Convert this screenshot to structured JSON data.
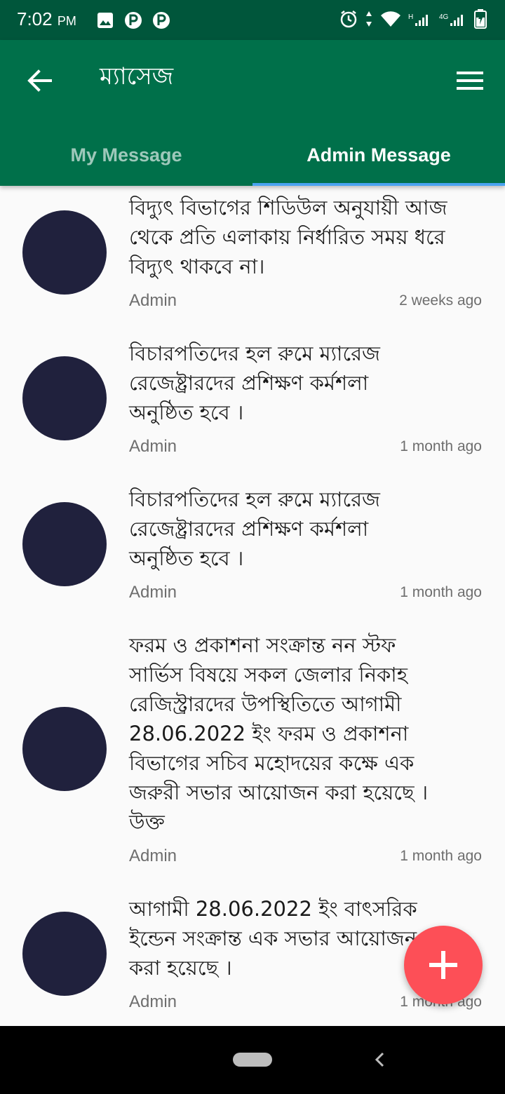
{
  "status_bar": {
    "time": "7:02",
    "ampm": "PM",
    "left_icons": [
      "image-icon",
      "parking-icon",
      "parking-icon"
    ],
    "right_icons": [
      "alarm-icon",
      "data-arrows-icon",
      "wifi-icon",
      "signal-h-icon",
      "signal-4g-icon",
      "battery-charging-icon"
    ],
    "network_h": "H",
    "network_4g": "4G"
  },
  "app_bar": {
    "title": "ম্যাসেজ",
    "back_icon": "arrow-left-icon",
    "menu_icon": "hamburger-menu-icon",
    "color": "#00704a"
  },
  "tabs": [
    {
      "label": "My Message",
      "active": false
    },
    {
      "label": "Admin Message",
      "active": true
    }
  ],
  "messages": [
    {
      "text": "বিদ্যুৎ বিভাগের শিডিউল  অনুযায়ী আজ\nথেকে প্রতি এলাকায় নির্ধারিত সময় ধরে\nবিদ্যুৎ থাকবে না।",
      "author": "Admin",
      "time": "2 weeks ago"
    },
    {
      "text": "বিচারপতিদের হল রুমে  ম্যারেজ\nরেজেষ্ট্রারদের প্রশিক্ষণ  কর্মশলা\nঅনুষ্ঠিত হবে ।",
      "author": "Admin",
      "time": "1 month ago"
    },
    {
      "text": "বিচারপতিদের হল রুমে  ম্যারেজ\nরেজেষ্ট্রারদের প্রশিক্ষণ  কর্মশলা\nঅনুষ্ঠিত হবে ।",
      "author": "Admin",
      "time": "1 month ago"
    },
    {
      "text": "ফরম ও প্রকাশনা সংক্রান্ত নন স্টফ\nসার্ভিস বিষয়ে সকল জেলার নিকাহ\nরেজিস্ট্রারদের উপস্থিতিতে আগামী\n28.06.2022 ইং ফরম ও প্রকাশনা\nবিভাগের সচিব মহোদয়ের কক্ষে এক\nজরুরী সভার আয়োজন করা হয়েছে ।\nউক্ত",
      "author": "Admin",
      "time": "1 month ago"
    },
    {
      "text": "আগামী 28.06.2022 ইং বাৎসরিক\nইন্ডেন সংক্রান্ত এক সভার আয়োজন\nকরা হয়েছে ।",
      "author": "Admin",
      "time": "1 month ago"
    }
  ],
  "fab": {
    "icon": "plus-icon",
    "color": "#fd4f57"
  },
  "nav_bar": {
    "home_icon": "home-pill-icon",
    "back_icon": "chevron-left-icon"
  }
}
